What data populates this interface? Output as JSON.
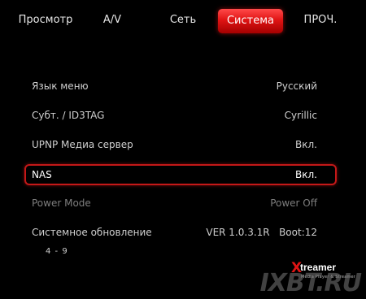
{
  "tabs": [
    {
      "label": "Просмотр",
      "active": false
    },
    {
      "label": "A/V",
      "active": false
    },
    {
      "label": "Сеть",
      "active": false
    },
    {
      "label": "Система",
      "active": true
    },
    {
      "label": "ПРОЧ.",
      "active": false
    }
  ],
  "settings": [
    {
      "label": "Язык меню",
      "value": "Русский",
      "selected": false,
      "enabled": true
    },
    {
      "label": "Субт. / ID3TAG",
      "value": "Cyrillic",
      "selected": false,
      "enabled": true
    },
    {
      "label": "UPNP Медиа сервер",
      "value": "Вкл.",
      "selected": false,
      "enabled": true
    },
    {
      "label": "NAS",
      "value": "Вкл.",
      "selected": true,
      "enabled": true
    },
    {
      "label": "Power Mode",
      "value": "Power Off",
      "selected": false,
      "enabled": false
    },
    {
      "label": "Системное обновление",
      "value": "VER 1.0.3.1R   Boot:12",
      "selected": false,
      "enabled": true
    }
  ],
  "page_indicator": "4 - 9",
  "brand": {
    "logo_x": "X",
    "name": "treamer",
    "tagline": "Media Player & Streamer"
  },
  "watermark": "IXBT.RU",
  "colors": {
    "accent": "#e01414",
    "background": "#000000",
    "text": "#cfcfcf",
    "disabled_text": "#7d7d7d"
  }
}
